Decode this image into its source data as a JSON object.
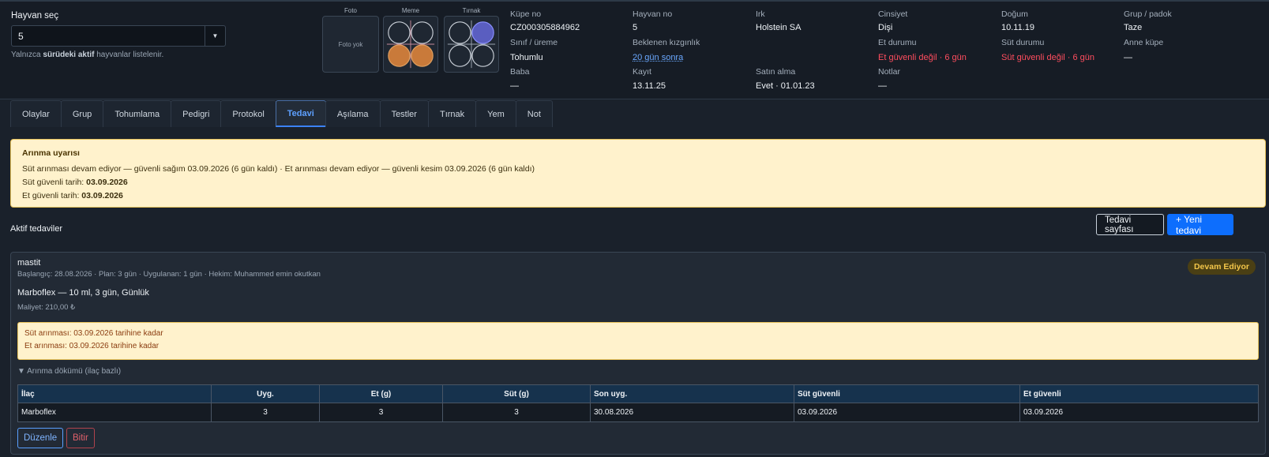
{
  "animal_select": {
    "title": "Hayvan seç",
    "selected": "5",
    "hint_prefix": "Yalnızca",
    "hint_bold": "sürüdeki aktif",
    "hint_suffix": "hayvanlar listelenir."
  },
  "images": {
    "photo_label": "Foto",
    "photo_empty": "Foto yok",
    "udder_label": "Meme",
    "hoof_label": "Tırnak"
  },
  "info": {
    "kupe_no": {
      "label": "Küpe no",
      "value": "CZ000305884962"
    },
    "hayvan_no": {
      "label": "Hayvan no",
      "value": "5"
    },
    "irk": {
      "label": "Irk",
      "value": "Holstein SA"
    },
    "cinsiyet": {
      "label": "Cinsiyet",
      "value": "Dişi"
    },
    "dogum": {
      "label": "Doğum",
      "value": "10.11.19"
    },
    "grup": {
      "label": "Grup / padok",
      "value": "Taze"
    },
    "sinif": {
      "label": "Sınıf / üreme",
      "value": "Tohumlu"
    },
    "kizginlik": {
      "label": "Beklenen kızgınlık",
      "value": "20 gün sonra"
    },
    "et_durumu": {
      "label": "Et durumu",
      "value": "Et güvenli değil · 6 gün"
    },
    "sut_durumu": {
      "label": "Süt durumu",
      "value": "Süt güvenli değil · 6 gün"
    },
    "anne_kupe": {
      "label": "Anne küpe",
      "value": "—"
    },
    "baba": {
      "label": "Baba",
      "value": "—"
    },
    "kayit": {
      "label": "Kayıt",
      "value": "13.11.25"
    },
    "satin_alma": {
      "label": "Satın alma",
      "value": "Evet · 01.01.23"
    },
    "notlar": {
      "label": "Notlar",
      "value": "—"
    }
  },
  "tabs": [
    "Olaylar",
    "Grup",
    "Tohumlama",
    "Pedigri",
    "Protokol",
    "Tedavi",
    "Aşılama",
    "Testler",
    "Tırnak",
    "Yem",
    "Not"
  ],
  "active_tab": "Tedavi",
  "withdrawal_warning": {
    "title": "Arınma uyarısı",
    "line1": "Süt arınması devam ediyor — güvenli sağım 03.09.2026 (6 gün kaldı) · Et arınması devam ediyor — güvenli kesim 03.09.2026 (6 gün kaldı)",
    "milk_label": "Süt güvenli tarih:",
    "milk_date": "03.09.2026",
    "meat_label": "Et güvenli tarih:",
    "meat_date": "03.09.2026"
  },
  "active_section": {
    "title": "Aktif tedaviler",
    "page_button": "Tedavi sayfası",
    "new_button": "+ Yeni tedavi"
  },
  "treatment": {
    "name": "mastit",
    "meta": "Başlangıç: 28.08.2026 · Plan: 3 gün · Uygulanan: 1 gün · Hekim: Muhammed emin okutkan",
    "status": "Devam Ediyor",
    "drug_line": "Marboflex — 10 ml, 3 gün, Günlük",
    "cost": "Maliyet: 210,00 ₺",
    "milk_withdrawal": "Süt arınması: 03.09.2026 tarihine kadar",
    "meat_withdrawal": "Et arınması: 03.09.2026 tarihine kadar",
    "breakdown_toggle": "▼ Arınma dökümü (ilaç bazlı)",
    "table": {
      "headers": [
        "İlaç",
        "Uyg.",
        "Et (g)",
        "Süt (g)",
        "Son uyg.",
        "Süt güvenli",
        "Et güvenli"
      ],
      "rows": [
        [
          "Marboflex",
          "3",
          "3",
          "3",
          "30.08.2026",
          "03.09.2026",
          "03.09.2026"
        ]
      ]
    },
    "edit_button": "Düzenle",
    "end_button": "Bitir"
  },
  "colors": {
    "accent": "#0d6efd",
    "danger": "#ff4d5e",
    "warning_bg": "#fff2cc",
    "badge_text": "#f3c64a"
  }
}
